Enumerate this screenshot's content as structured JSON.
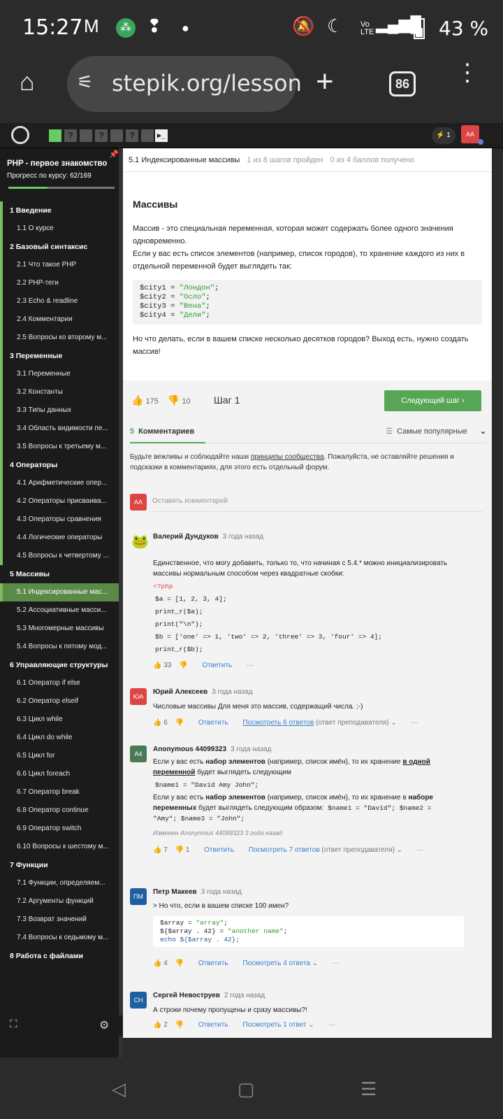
{
  "status_bar": {
    "time": "15:27",
    "battery": "43 %",
    "icons": [
      "gmail-icon",
      "app-icon",
      "notification-icon",
      "dot-icon",
      "mute-icon",
      "moon-icon",
      "volte-icon",
      "lte-signal-icon",
      "battery-icon"
    ]
  },
  "browser": {
    "url": "stepik.org/lesson",
    "tab_count": "86"
  },
  "topnav": {
    "badge_count": "1",
    "user_initials": "AA"
  },
  "sidebar": {
    "course_title": "PHP - первое знакомство",
    "progress_text": "Прогресс по курсу:  62/169",
    "progress_fraction": 0.37,
    "sections": [
      {
        "title": "1  Введение",
        "items": [
          "1.1  О курсе"
        ]
      },
      {
        "title": "2  Базовый синтаксис",
        "items": [
          "2.1  Что такое PHP",
          "2.2  PHP-теги",
          "2.3  Echo & readline",
          "2.4  Комментарии",
          "2.5  Вопросы ко второму м..."
        ]
      },
      {
        "title": "3  Переменные",
        "items": [
          "3.1  Переменные",
          "3.2  Константы",
          "3.3  Типы данных",
          "3.4  Область видимости пе...",
          "3.5  Вопросы к третьему м..."
        ]
      },
      {
        "title": "4  Операторы",
        "items": [
          "4.1  Арифметические опер...",
          "4.2  Операторы присваива...",
          "4.3  Операторы сравнения",
          "4.4  Логические операторы",
          "4.5  Вопросы к четвертому ..."
        ]
      },
      {
        "title": "5  Массивы",
        "items": [
          "5.1  Индексированные мас...",
          "5.2  Ассоциативные масси...",
          "5.3  Многомерные массивы",
          "5.4  Вопросы к пятому мод..."
        ]
      },
      {
        "title": "6  Управляющие структуры",
        "items": [
          "6.1  Оператор if else",
          "6.2  Оператор elseif",
          "6.3  Цикл while",
          "6.4  Цикл do while",
          "6.5  Цикл for",
          "6.6  Цикл foreach",
          "6.7  Оператор break",
          "6.8  Оператор continue",
          "6.9  Оператор switch",
          "6.10  Вопросы к шестому м..."
        ]
      },
      {
        "title": "7  Функции",
        "items": [
          "7.1  Функции, определяем...",
          "7.2  Аргументы функций",
          "7.3  Возврат значений",
          "7.4  Вопросы к седьмому м..."
        ]
      },
      {
        "title": "8  Работа с файлами",
        "items": []
      }
    ]
  },
  "breadcrumb": {
    "lesson": "5.1 Индексированные массивы",
    "steps": "1 из 8 шагов пройден",
    "points": "0 из 4 баллов  получено"
  },
  "lesson": {
    "title": "Массивы",
    "para1": "Массив - это специальная переменная, которая может содержать более одного значения одновременно.",
    "para2": "Если у вас есть список элементов (например, список городов), то хранение каждого из них в отдельной переменной будет выглядеть так:",
    "code": [
      {
        "var": "$city1 = ",
        "str": "\"Лондон\"",
        "end": ";"
      },
      {
        "var": "$city2 = ",
        "str": "\"Осло\"",
        "end": ";"
      },
      {
        "var": "$city3 = ",
        "str": "\"Вена\"",
        "end": ";"
      },
      {
        "var": "$city4 = ",
        "str": "\"Дели\"",
        "end": ";"
      }
    ],
    "para3": "Но что делать, если в вашем списке несколько десятков городов? Выход есть, нужно создать массив!"
  },
  "step_bar": {
    "likes": "175",
    "dislikes": "10",
    "step": "Шаг 1",
    "next_label": "Следующий шаг"
  },
  "comments_tab": {
    "count": "5",
    "label": "Комментариев",
    "sort": "Самые популярные",
    "rules_pre": "Будьте вежливы и соблюдайте наши ",
    "rules_link": "принципы сообщества",
    "rules_post": ". Пожалуйста, не оставляйте решения и подсказки в комментариях, для этого есть отдельный форум.",
    "new_initials": "AA",
    "new_placeholder": "Оставить комментарий"
  },
  "comments": [
    {
      "author": "Валерий Дундуков",
      "time": "3 года назад",
      "text": "Единственное, что могу добавить, только то, что начиная с 5.4.* можно инициализировать массивы нормальным способом через квадратные скобки:",
      "code": [
        "<?php",
        "$a = [1, 2, 3, 4];",
        "print_r($a);",
        "print(\"\\n\");",
        "$b = ['one' => 1, 'two' => 2, 'three' => 3, 'four' => 4];",
        "print_r($b);"
      ],
      "likes": "33",
      "reply": "Ответить"
    },
    {
      "initials": "ЮА",
      "author": "Юрий Алексеев",
      "time": "3 года назад",
      "text": "Числовые массивы Для меня это массив, содержащий числа. ;-)",
      "likes": "6",
      "reply": "Ответить",
      "thread": "Посмотреть 6 ответов",
      "thread_note": "(ответ преподавателя)"
    },
    {
      "initials": "A4",
      "author": "Anonymous 44099323",
      "time": "3 года назад",
      "t1": "Если у вас есть ",
      "t1b": "набор элементов",
      "t2": " (например, список имён), то их хранение ",
      "t2b": "в одной переменной",
      "t3": " будет выглядеть следующим",
      "code1": "$name1 = \"David Amy John\";",
      "t4": "Если у вас есть ",
      "t4b": "набор элементов",
      "t5": " (например, список имён), то их хранение в ",
      "t5b": "наборе переменных",
      "t6": " будет выглядеть следующим образом: ",
      "code2": "$name1 = \"David\";    $name2 = \"Amy\";    $name3 = \"John\";",
      "edited": "Изменен Anonymous 44099323 3 года назад",
      "likes": "7",
      "dislikes": "1",
      "reply": "Ответить",
      "thread": "Посмотреть 7 ответов",
      "thread_note": "(ответ преподавателя)"
    },
    {
      "initials": "ПМ",
      "author": "Петр Макеев",
      "time": "3 года назад",
      "text": "> Но что, если в вашем списке 100 имен?",
      "code": [
        {
          "a": "$array = ",
          "b": "\"array\"",
          "c": ";"
        },
        {
          "a": "${$array . 42} = ",
          "b": "\"another name\"",
          "c": ";"
        },
        {
          "a": "echo ${$array . 42};",
          "b": "",
          "c": ""
        }
      ],
      "likes": "4",
      "reply": "Ответить",
      "thread": "Посмотреть 4 ответа"
    },
    {
      "initials": "СН",
      "author": "Сергей Невоструев",
      "time": "2 года назад",
      "text": "А строки почему пропущены и сразу массивы?!",
      "likes": "2",
      "reply": "Ответить",
      "thread": "Посмотреть 1 ответ"
    }
  ],
  "colors": {
    "accent": "#56a656",
    "link": "#3a7fd0",
    "sidebar_bg": "#1b1b1b",
    "avatar_red": "#d44",
    "avatar_green": "#4a7a55",
    "avatar_blue": "#1e5fa0"
  }
}
